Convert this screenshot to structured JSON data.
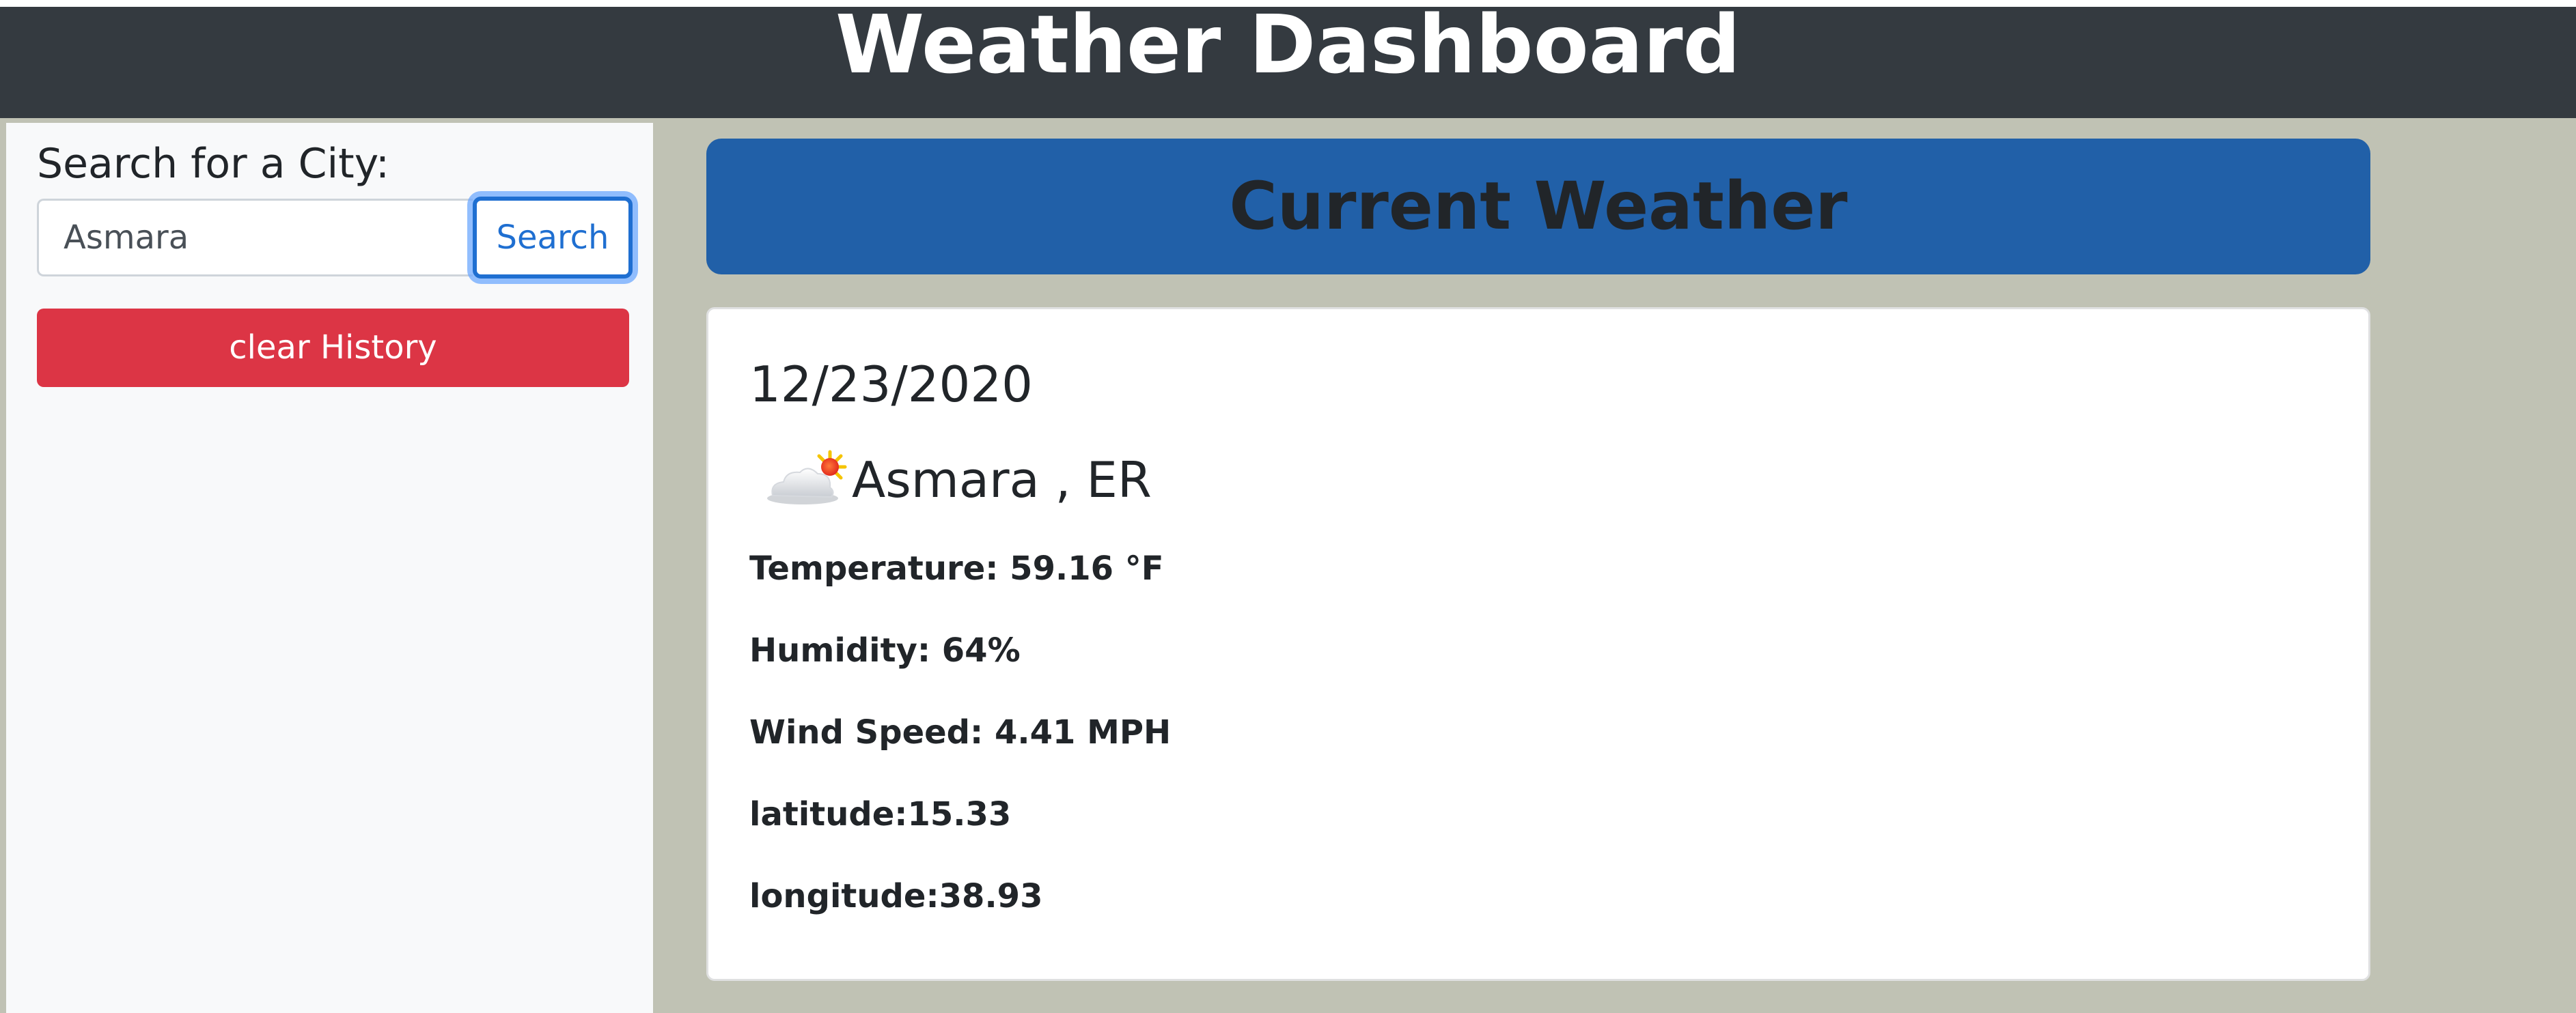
{
  "header": {
    "title": "Weather Dashboard"
  },
  "sidebar": {
    "search_label": "Search for a City:",
    "search_value": "Asmara",
    "search_button": "Search",
    "clear_button": "clear History"
  },
  "main": {
    "banner_title": "Current Weather",
    "date": "12/23/2020",
    "weather_icon": "partly-cloudy-sun-icon",
    "city": "Asmara , ER",
    "temperature": "Temperature: 59.16 °F",
    "humidity": "Humidity: 64%",
    "wind_speed": "Wind Speed: 4.41 MPH",
    "latitude": "latitude:15.33",
    "longitude": "longitude:38.93"
  },
  "colors": {
    "header_bg": "#343a40",
    "page_bg": "#c0c2b4",
    "sidebar_bg": "#f8f9fa",
    "banner_bg": "#2160a8",
    "danger": "#dc3545",
    "primary": "#1f6fd1"
  }
}
